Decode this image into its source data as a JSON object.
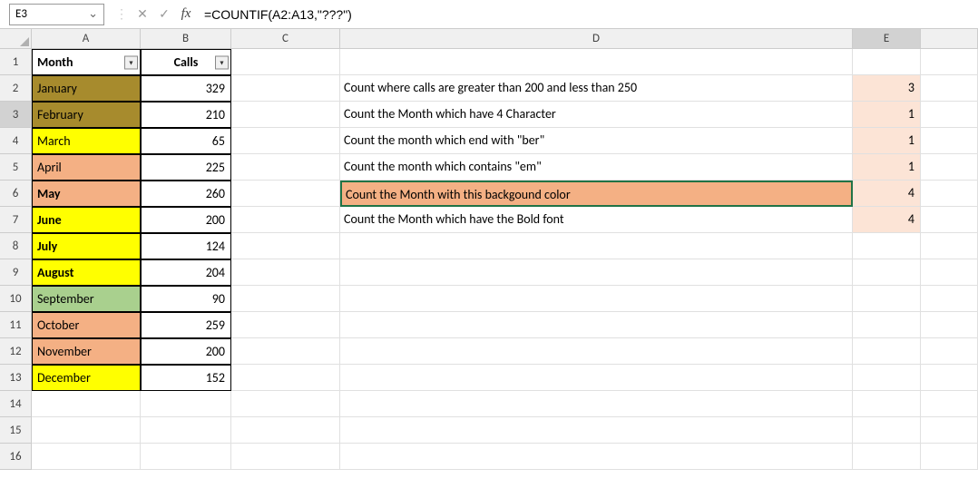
{
  "nameBox": "E3",
  "formula": "=COUNTIF(A2:A13,\"???\")",
  "columns": [
    "A",
    "B",
    "C",
    "D",
    "E",
    ""
  ],
  "tableHeaders": {
    "a": "Month",
    "b": "Calls"
  },
  "months": [
    {
      "name": "January",
      "calls": "329",
      "bg": "bg-olive",
      "bold": false
    },
    {
      "name": "February",
      "calls": "210",
      "bg": "bg-olive",
      "bold": false
    },
    {
      "name": "March",
      "calls": "65",
      "bg": "bg-yellow",
      "bold": false
    },
    {
      "name": "April",
      "calls": "225",
      "bg": "bg-peach",
      "bold": false
    },
    {
      "name": "May",
      "calls": "260",
      "bg": "bg-peach",
      "bold": true
    },
    {
      "name": "June",
      "calls": "200",
      "bg": "bg-yellow",
      "bold": true
    },
    {
      "name": "July",
      "calls": "124",
      "bg": "bg-yellow",
      "bold": true
    },
    {
      "name": "August",
      "calls": "204",
      "bg": "bg-yellow",
      "bold": true
    },
    {
      "name": "September",
      "calls": "90",
      "bg": "bg-green",
      "bold": false
    },
    {
      "name": "October",
      "calls": "259",
      "bg": "bg-peach",
      "bold": false
    },
    {
      "name": "November",
      "calls": "200",
      "bg": "bg-peach",
      "bold": false
    },
    {
      "name": "December",
      "calls": "152",
      "bg": "bg-yellow",
      "bold": false
    }
  ],
  "descriptions": [
    {
      "text": "Count where calls are greater than  200 and less than 250",
      "result": "3",
      "dbg": "",
      "ebg": "bg-peach-light"
    },
    {
      "text": "Count the Month which have 4 Character",
      "result": "1",
      "dbg": "",
      "ebg": "bg-peach-light"
    },
    {
      "text": "Count the month which end with \"ber\"",
      "result": "1",
      "dbg": "",
      "ebg": "bg-peach-light"
    },
    {
      "text": "Count the month which contains \"em\"",
      "result": "1",
      "dbg": "",
      "ebg": "bg-peach-light"
    },
    {
      "text": "Count the Month with this backgound color",
      "result": "4",
      "dbg": "bg-peach",
      "ebg": "bg-peach-light",
      "selected": true
    },
    {
      "text": "Count the Month which have the Bold font",
      "result": "4",
      "dbg": "",
      "ebg": "bg-peach-light"
    }
  ],
  "fx_label": "fx",
  "chevron": "⌄",
  "filter_glyph": "▼"
}
